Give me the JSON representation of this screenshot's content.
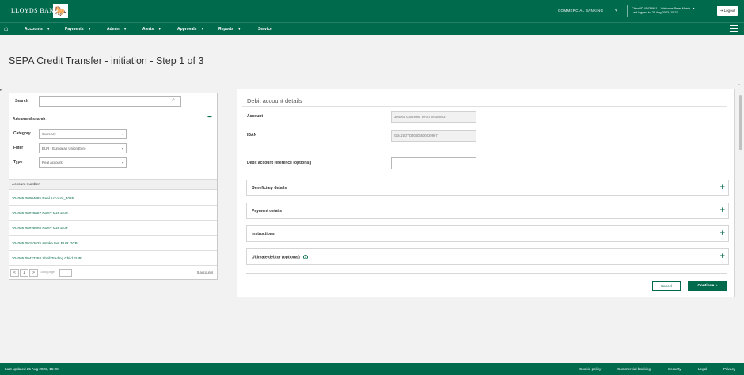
{
  "header": {
    "brand": "LLOYDS BANK",
    "brand_logo_glyph": "🐎",
    "commercial": "COMMERCIAL BANKING",
    "client": "Client ID 45435981",
    "welcome": "Welcome Peter Morris",
    "last_logged": "Last logged in: 25 Aug 2023, 15:37",
    "logout": "Logout"
  },
  "nav": {
    "items": [
      "Accounts",
      "Payments",
      "Admin",
      "Alerts",
      "Approvals",
      "Reports",
      "Service"
    ]
  },
  "page": {
    "title": "SEPA Credit Transfer - initiation - Step 1 of 3"
  },
  "left": {
    "search_label": "Search",
    "search_placeholder": "",
    "advanced_search": "Advanced search",
    "filters": [
      {
        "label": "Category",
        "value": "Currency"
      },
      {
        "label": "Filter",
        "value": "EUR - European Union Euro"
      },
      {
        "label": "Type",
        "value": "Real account"
      }
    ],
    "accounts_header": "Account number",
    "accounts": [
      "304065 00004085 Real Account_4085",
      "304065 00029967 DAST testuser3",
      "304065 00038808 DAST testuser4",
      "304065 00152625 smoke test EUR OCB",
      "304065 00423258 Shell Trading Child EUR"
    ],
    "pager": {
      "prev": "<",
      "page": "1",
      "next": ">",
      "goto_label": "Go to page",
      "count": "5 accounts"
    }
  },
  "right": {
    "title": "Debit account details",
    "account_label": "Account",
    "account_value": "304065 00029967 DAST testuser3",
    "iban_label": "IBAN",
    "iban_value": "GB42LOYD30406500029967",
    "reference_label": "Debit account reference (optional)",
    "sections": [
      "Beneficiary details",
      "Payment details",
      "Instructions",
      "Ultimate debtor (optional)"
    ],
    "info_glyph": "i",
    "cancel": "Cancel",
    "continue": "Continue",
    "continue_arrow": "›"
  },
  "footer": {
    "last_updated": "Last updated 25 Aug 2023, 15:28",
    "links": [
      "Cookie policy",
      "Commercial banking",
      "Security",
      "Legal",
      "Privacy"
    ]
  },
  "colors": {
    "brand_green": "#006a4d",
    "background": "#f2f2f2",
    "panel": "#ffffff"
  },
  "icons": {
    "home": "home-icon",
    "menu": "hamburger-menu-icon",
    "search": "search-icon",
    "expand": "plus-icon",
    "collapse": "minus-icon",
    "info": "info-icon"
  }
}
